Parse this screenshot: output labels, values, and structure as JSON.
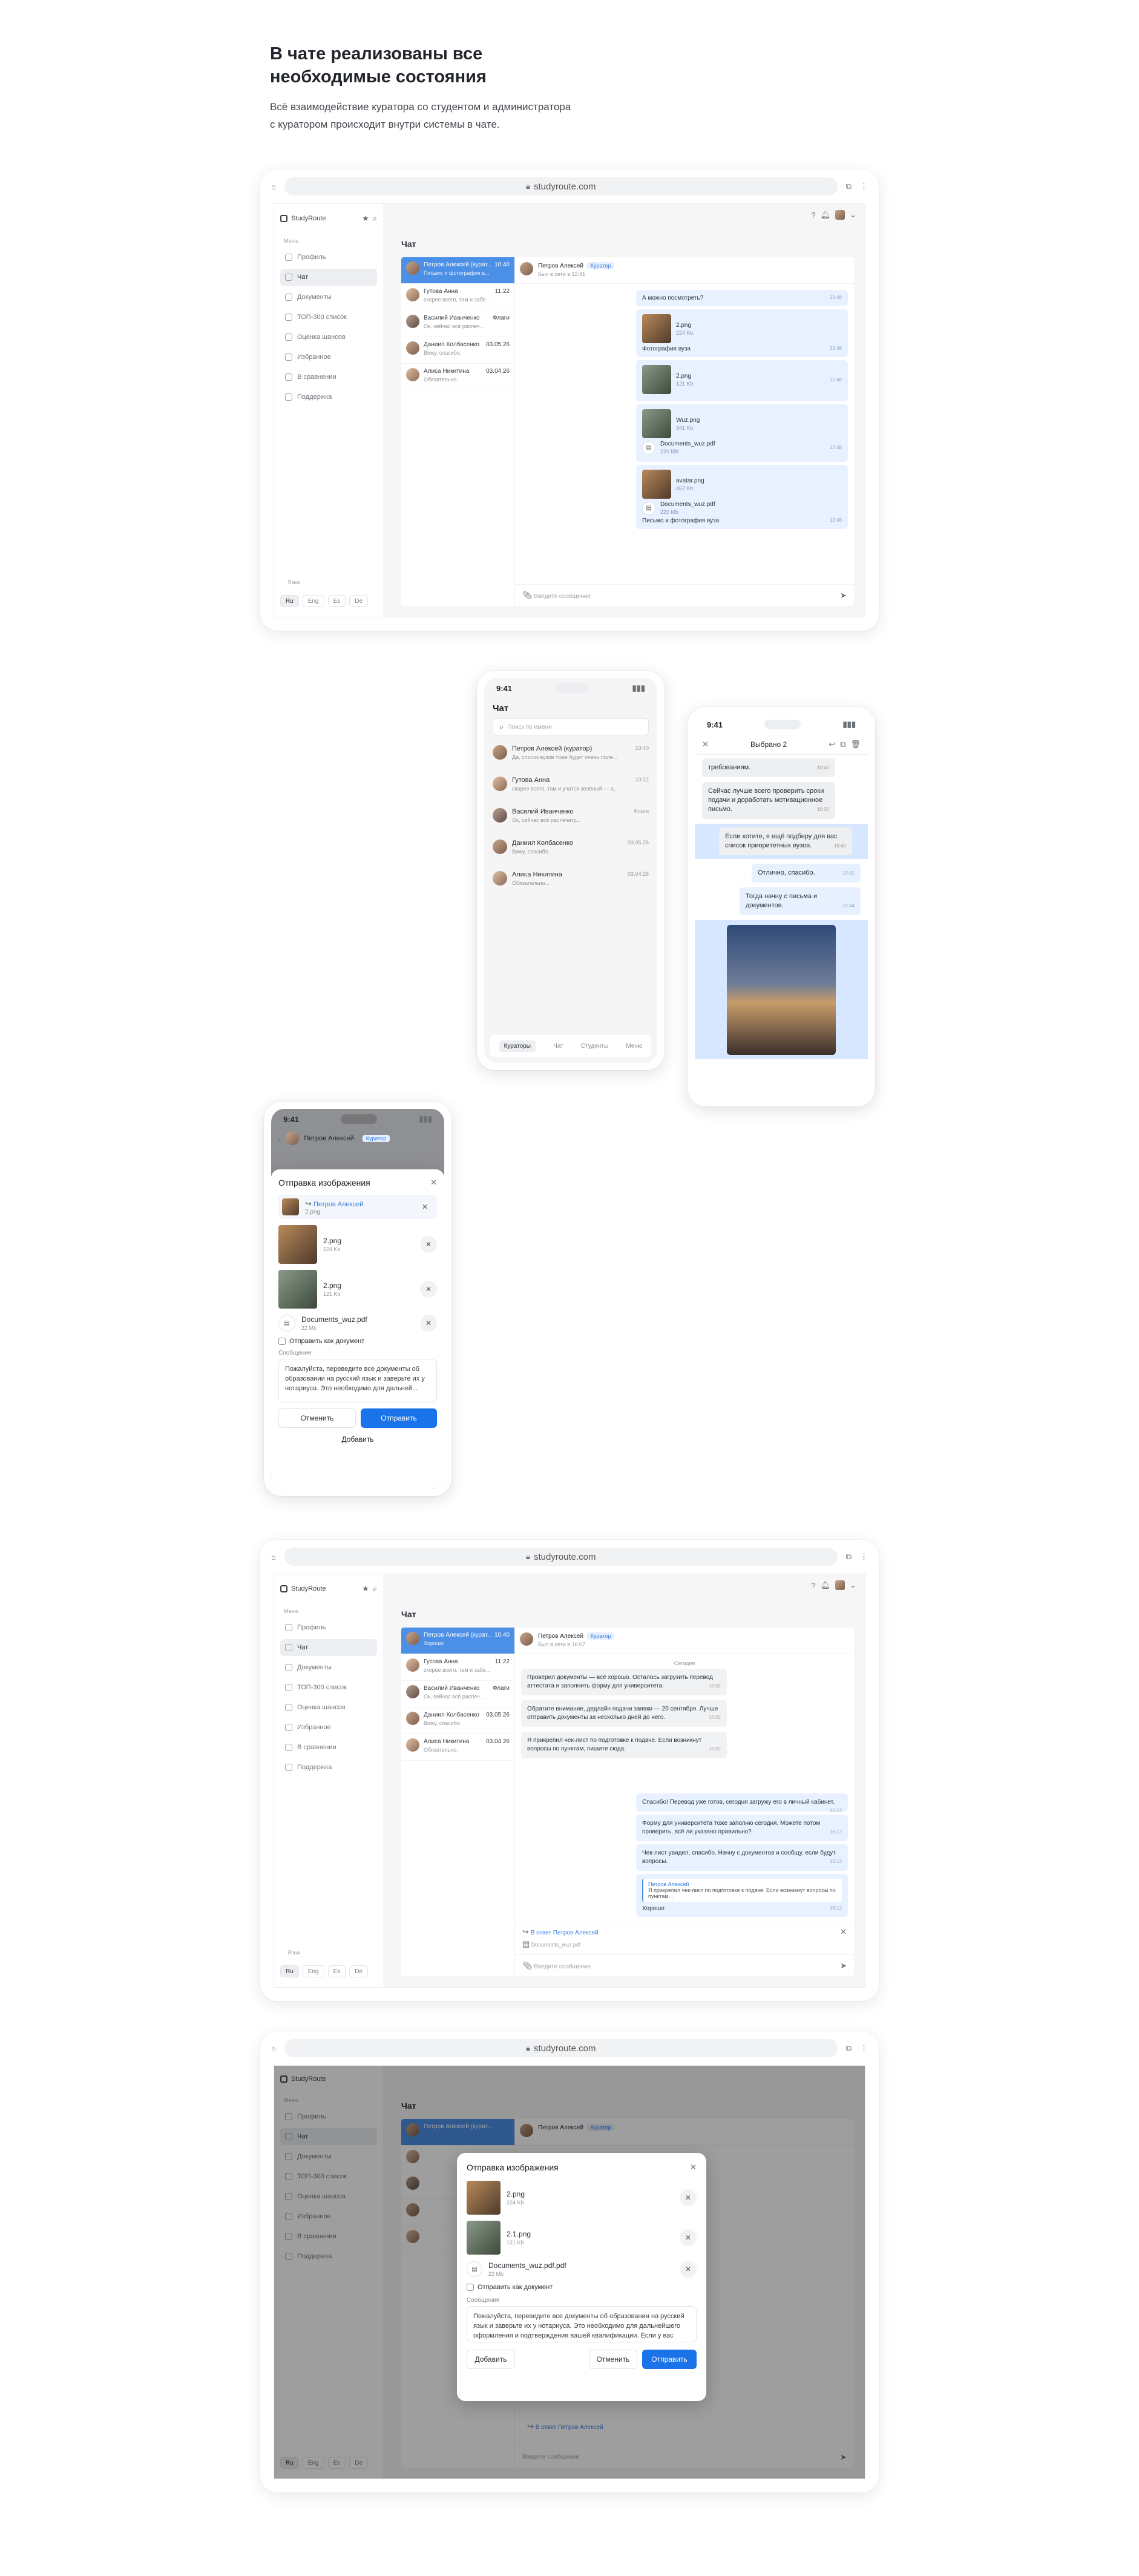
{
  "intro": {
    "title_line1": "В чате реализованы все",
    "title_line2": "необходимые состояния",
    "desc_line1": "Всё взаимодействие куратора со студентом и администратора",
    "desc_line2": "с куратором происходит внутри системы в чате."
  },
  "browser": {
    "url": "studyroute.com"
  },
  "app": {
    "logo": "StudyRoute",
    "menu_caption": "Меню",
    "nav": [
      "Профиль",
      "Чат",
      "Документы",
      "ТОП-300 список",
      "Оценка шансов",
      "Избранное",
      "В сравнении",
      "Поддержка"
    ],
    "lang_caption": "Язык",
    "langs": [
      "Ru",
      "Eng",
      "Es",
      "De"
    ],
    "page_title": "Чат",
    "input_placeholder": "Введите сообщение"
  },
  "chat_list": [
    {
      "name": "Петров Алексей (курат...",
      "time": "10:40",
      "sub": "Письмо и фотография в..."
    },
    {
      "name": "Гутова Анна",
      "time": "11:22",
      "sub": "скорее всего, там и забе..."
    },
    {
      "name": "Василий Иванченко",
      "time": "Флаги",
      "sub": "Ок, сейчас всё распеч..."
    },
    {
      "name": "Даниил Колбасенко",
      "time": "03.05.26",
      "sub": "Вижу, спасибо."
    },
    {
      "name": "Алиса Никитина",
      "time": "03.04.26",
      "sub": "Обязательно."
    }
  ],
  "screen1": {
    "head_name": "Петров Алексей",
    "head_badge": "Куратор",
    "head_status": "Был в сети в 12:41",
    "q": "А можно посмотреть?",
    "q_time": "12:48",
    "f1": "2.png",
    "f1_size": "224 Kb",
    "cap1": "Фотография вуза",
    "cap1_time": "12:48",
    "f2": "2.png",
    "f2_size": "121 Kb",
    "f2_time": "12:48",
    "f3": "Wuz.png",
    "f3_size": "341 Kb",
    "f4": "Documents_wuz.pdf",
    "f4_size": "220 Mb",
    "f4_time": "12:48",
    "f5": "avatar.png",
    "f5_size": "462 Kb",
    "f6": "Documents_wuz.pdf",
    "f6_size": "220 Mb",
    "cap2": "Письмо и фотография вуза",
    "cap2_time": "12:48"
  },
  "phone1": {
    "time": "9:41",
    "title": "Чат",
    "search_placeholder": "Поиск по имени",
    "rows": [
      {
        "name": "Петров Алексей (куратор)",
        "time": "10:40",
        "sub": "Да, список вузов тоже будет очень поле..."
      },
      {
        "name": "Гутова Анна",
        "time": "10:22",
        "sub": "скорее всего, там и учатся зелёный — а..."
      },
      {
        "name": "Василий Иванченко",
        "time": "Флаги",
        "sub": "Ок, сейчас всё распечату..."
      },
      {
        "name": "Даниил Колбасенко",
        "time": "03.05.26",
        "sub": "Вижу, спасибо."
      },
      {
        "name": "Алиса Никитина",
        "time": "03.04.26",
        "sub": "Обязательно..."
      }
    ],
    "tabs": [
      "Кураторы",
      "Чат",
      "Студенты",
      "Меню"
    ]
  },
  "phone2": {
    "time": "9:41",
    "selected": "Выбрано 2",
    "m0": "требованиям.",
    "m0_time": "10:40",
    "m1": "Сейчас лучше всего проверить сроки подачи и доработать мотивационное письмо.",
    "m1_time": "10:35",
    "m2": "Если хотите, я ещё подберу для вас список приоритетных вузов.",
    "m2_time": "10:40",
    "m3": "Отлично, спасибо.",
    "m3_time": "10:41",
    "m4": "Тогда начну с письма и документов.",
    "m4_time": "10:44"
  },
  "phone3": {
    "time": "9:41",
    "head_name": "Петров Алексей",
    "head_badge": "Куратор",
    "title": "Отправка изображения",
    "reply_to": "Петров Алексей",
    "reply_file": "2.png",
    "f1": "2.png",
    "f1_size": "224 Kb",
    "f2": "2.png",
    "f2_size": "121 Kb",
    "f3": "Documents_wuz.pdf",
    "f3_size": "22 Mb",
    "as_doc": "Отправить как документ",
    "msg_caption": "Сообщение",
    "msg_text": "Пожалуйста, переведите все документы об образовании на русский язык и заверьте их у нотариуса. Это необходимо для дальней...",
    "cancel": "Отменить",
    "send": "Отправить",
    "add": "Добавить"
  },
  "screen2": {
    "head_name": "Петров Алексей",
    "head_badge": "Куратор",
    "head_status": "Был в сети в 16:07",
    "day": "Сегодня",
    "in1": "Проверил документы — всё хорошо. Осталось загрузить перевод аттестата и заполнить форму для университета.",
    "in1_time": "16:02",
    "in2": "Обратите внимание, дедлайн подачи заявки — 20 сентября. Лучше отправить документы за несколько дней до него.",
    "in2_time": "16:02",
    "in3": "Я прикрепил чек-лист по подготовке к подаче. Если возникнут вопросы по пунктам, пишите сюда.",
    "in3_time": "16:02",
    "out1": "Спасибо! Перевод уже готов, сегодня загружу его в личный кабинет.",
    "out1_time": "16:12",
    "out2": "Форму для университета тоже заполню сегодня. Можете потом проверить, всё ли указано правильно?",
    "out2_time": "16:12",
    "out3": "Чек-лист увидел, спасибо. Начну с документов и сообщу, если будут вопросы.",
    "out3_time": "16:12",
    "quote_name": "Петров Алексей",
    "quote_text": "Я прикрепил чек-лист по подготовке к подаче. Если возникнут вопросы по пунктам...",
    "out4": "Хорошо",
    "out4_time": "16:12",
    "reply_label": "В ответ Петров Алексей",
    "reply_file": "Documents_wuz.pdf"
  },
  "screen3": {
    "title": "Отправка изображения",
    "f1": "2.png",
    "f1_size": "224 Kb",
    "f2": "2.1.png",
    "f2_size": "121 Kb",
    "f3": "Documents_wuz.pdf.pdf",
    "f3_size": "22 Mb",
    "as_doc": "Отправить как документ",
    "msg_caption": "Сообщение",
    "msg_text": "Пожалуйста, переведите все документы об образовании на русский язык и заверьте их у нотариуса. Это необходимо для дальнейшего оформления и подтверждения вашей квалификации. Если у вас возникнут вопросы по",
    "add": "Добавить",
    "cancel": "Отменить",
    "send": "Отправить",
    "reply_label": "В ответ Петров Алексей"
  }
}
